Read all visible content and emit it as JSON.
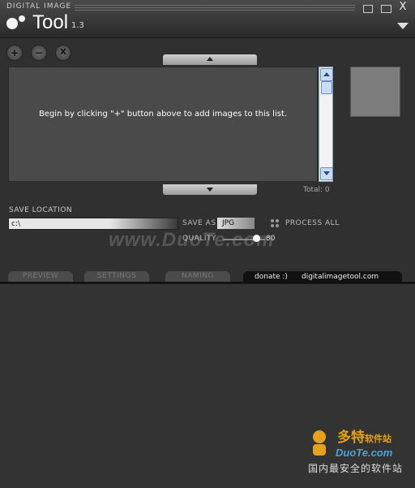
{
  "window": {
    "brand_small": "DIGITAL IMAGE",
    "app_name": "Tool",
    "version": "1.3",
    "close_label": "X"
  },
  "toolbar": {
    "add_label": "+",
    "remove_label": "−",
    "clear_label": "X"
  },
  "list": {
    "empty_message": "Begin by clicking \"+\" button above to add images to this list.",
    "total_text": "Total: 0"
  },
  "save": {
    "location_label": "SAVE LOCATION",
    "location_value": "c:\\",
    "save_as_label": "SAVE AS",
    "format_value": "JPG",
    "process_all_label": "PROCESS ALL",
    "quality_label": "QUALITY",
    "quality_value": "80",
    "quality_fraction": 0.8
  },
  "tabs": {
    "preview": "PREVIEW",
    "settings": "SETTINGS",
    "naming": "NAMING",
    "donate": "donate :)",
    "website": "digitalimagetool.com"
  },
  "watermarks": {
    "center": "www.DuoTe.com",
    "corner_cn_title": "多特",
    "corner_cn_sub": "软件站",
    "corner_domain": "DuoTe.com",
    "corner_cn_line": "国内最安全的软件站"
  },
  "colors": {
    "background": "#303030",
    "accent_orange": "#e6a21a",
    "accent_blue": "#4aa3e0"
  }
}
